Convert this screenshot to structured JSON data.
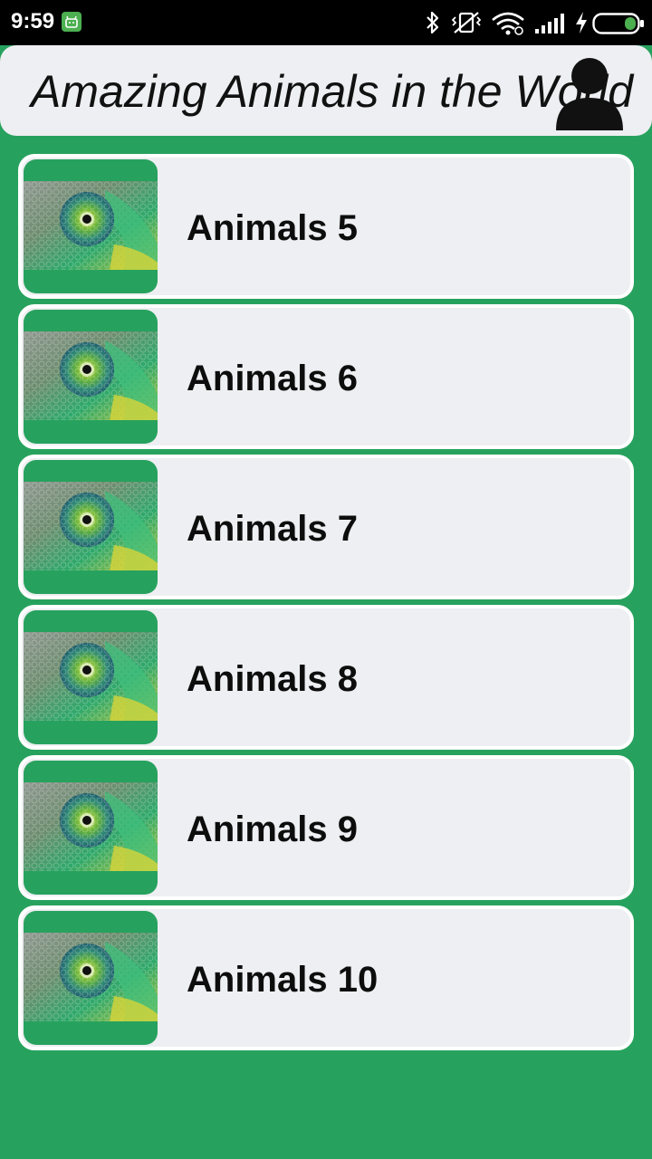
{
  "status_bar": {
    "time": "9:59",
    "icons": [
      "android-notification-icon",
      "bluetooth-icon",
      "vibrate-off-icon",
      "wifi-icon",
      "signal-icon",
      "charging-icon",
      "battery-icon"
    ]
  },
  "header": {
    "title": "Amazing Animals in the World",
    "profile_icon": "profile-icon"
  },
  "list": {
    "items": [
      {
        "label": "Animals 5",
        "image": "chameleon-eye-thumbnail"
      },
      {
        "label": "Animals 6",
        "image": "chameleon-eye-thumbnail"
      },
      {
        "label": "Animals 7",
        "image": "chameleon-eye-thumbnail"
      },
      {
        "label": "Animals 8",
        "image": "chameleon-eye-thumbnail"
      },
      {
        "label": "Animals 9",
        "image": "chameleon-eye-thumbnail"
      },
      {
        "label": "Animals 10",
        "image": "chameleon-eye-thumbnail"
      }
    ]
  },
  "colors": {
    "background": "#27a25e",
    "card": "#eeeff2",
    "status_bar": "#000000",
    "battery_fill": "#4caf50"
  }
}
